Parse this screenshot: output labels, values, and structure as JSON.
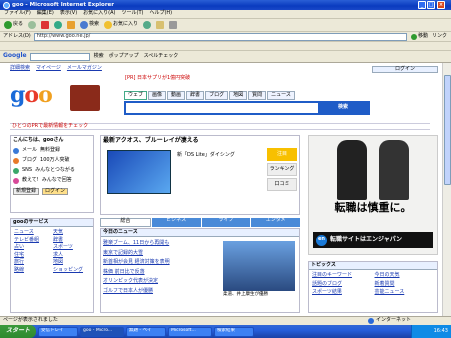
{
  "window": {
    "title": "goo - Microsoft Internet Explorer"
  },
  "menu": [
    "ファイル(F)",
    "編集(E)",
    "表示(V)",
    "お気に入り(A)",
    "ツール(T)",
    "ヘルプ(H)"
  ],
  "toolbar": {
    "back_label": "戻る",
    "search_label": "検索",
    "favorites_label": "お気に入り"
  },
  "address": {
    "label": "アドレス(D)",
    "value": "http://www.goo.ne.jp/",
    "go_label": "移動"
  },
  "links_bar": {
    "label": "リンク"
  },
  "google_bar": {
    "logo": "Google",
    "search_label": "検索",
    "popup_label": "ポップアップ",
    "check_label": "スペルチェック"
  },
  "page": {
    "logo": "goo",
    "top_links": [
      "詳細検索",
      "マイページ",
      "メールマガジン"
    ],
    "login_text": "ログイン",
    "nav_tabs": [
      "ウェブ",
      "画像",
      "動画",
      "辞書",
      "ブログ",
      "地図",
      "質問",
      "ニュース"
    ],
    "search_button": "検索",
    "headline_ticker": "[PR] 日本サプリが1億円突破",
    "pr_line": "ひとつのPRで最新情報をチェック",
    "left": {
      "greeting": "こんにちは、gooさん",
      "items": [
        {
          "icon": "mail-icon",
          "label": "メール",
          "desc": "無料登録"
        },
        {
          "icon": "blog-icon",
          "label": "ブログ",
          "desc": "100万人突破"
        },
        {
          "icon": "sns-icon",
          "label": "SNS",
          "desc": "みんなとつながる"
        },
        {
          "icon": "answer-icon",
          "label": "教えて!",
          "desc": "みんなで回答"
        }
      ],
      "register_label": "新規登録",
      "login_label": "ログイン",
      "services_title": "gooのサービス",
      "services": [
        "ニュース",
        "天気",
        "テレビ番組",
        "辞書",
        "占い",
        "スポーツ",
        "住宅",
        "求人",
        "旅行",
        "地図",
        "路線",
        "ショッピング"
      ]
    },
    "center": {
      "feature_title": "最新アクオス、ブルーレイが凄える",
      "feature_caption": "新「DS Lite」ダイシング",
      "side_buttons": [
        "注目",
        "ランキング",
        "口コミ"
      ],
      "tabs": [
        "総合",
        "ビジネス",
        "ライフ",
        "エンタメ"
      ],
      "news_title": "今日のニュース",
      "news": [
        "雅楽ブーム、11日から再開も",
        "東京で記録的大雪",
        "新首相が会見 経済対策を表明",
        "株価 前日比で反落",
        "オリンピック代表が決定",
        "ゴルフで日本人が優勝"
      ],
      "photo_caption": "柔道、井上康生が優勝"
    },
    "right": {
      "ad_slogan": "転職は慎重に。",
      "ad_brand": "転職サイトはエンジャパン",
      "ad_logo": "en",
      "bottom_title": "トピックス",
      "bottom_links": [
        "注目のキーワード",
        "今日の天気",
        "話題のブログ",
        "新着質問",
        "スポーツ結果",
        "芸能ニュース"
      ]
    }
  },
  "status": {
    "text": "ページが表示されました",
    "zone": "インターネット"
  },
  "taskbar": {
    "start": "スタート",
    "tasks": [
      "受信トレイ",
      "goo - Micro...",
      "無題 - ペイ",
      "Microsoft...",
      "検索結果"
    ],
    "clock": "16:43"
  }
}
